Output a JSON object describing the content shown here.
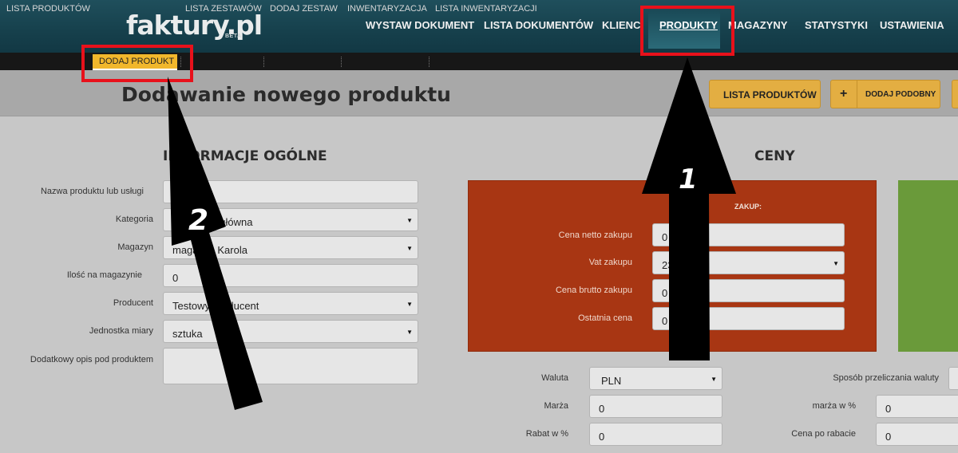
{
  "header": {
    "logo": "faktury.pl",
    "logo_badge": "BETA",
    "nav": [
      "WYSTAW DOKUMENT",
      "LISTA DOKUMENTÓW",
      "KLIENCI",
      "PRODUKTY",
      "MAGAZYNY",
      "STATYSTYKI",
      "USTAWIENIA"
    ],
    "nav_active": "PRODUKTY"
  },
  "subnav": {
    "items": [
      "LISTA PRODUKTÓW",
      "DODAJ PRODUKT",
      "LISTA ZESTAWÓW",
      "DODAJ ZESTAW",
      "INWENTARYZACJA",
      "LISTA INWENTARYZACJI"
    ],
    "active": "DODAJ PRODUKT"
  },
  "page": {
    "title": "Dodawanie nowego produktu",
    "buttons": {
      "list": "LISTA PRODUKTÓW",
      "add_similar_icon": "+",
      "add_similar": "DODAJ PODOBNY"
    }
  },
  "general": {
    "heading": "INFORMACJE OGÓLNE",
    "fields": [
      {
        "label": "Nazwa produktu lub usługi",
        "value": "",
        "type": "text"
      },
      {
        "label": "Kategoria",
        "value": "Kategoria główna",
        "type": "select"
      },
      {
        "label": "Magazyn",
        "value": "magazyn Karola",
        "type": "select"
      },
      {
        "label": "Ilość na magazynie",
        "value": "0",
        "type": "text"
      },
      {
        "label": "Producent",
        "value": "Testowy producent",
        "type": "select"
      },
      {
        "label": "Jednostka miary",
        "value": "sztuka",
        "type": "select"
      },
      {
        "label": "Dodatkowy opis pod produktem",
        "value": "",
        "type": "textarea"
      }
    ]
  },
  "prices": {
    "heading": "CENY",
    "purchase": {
      "title": "ZAKUP:",
      "fields": [
        {
          "label": "Cena netto zakupu",
          "value": "0"
        },
        {
          "label": "Vat zakupu",
          "value": "23%",
          "type": "select"
        },
        {
          "label": "Cena brutto zakupu",
          "value": "0"
        },
        {
          "label": "Ostatnia cena",
          "value": "0"
        }
      ]
    },
    "currency": {
      "label": "Waluta",
      "value": "PLN"
    },
    "margin": {
      "label": "Marża",
      "value": "0"
    },
    "discount": {
      "label": "Rabat w %",
      "value": "0"
    },
    "conversion": {
      "label": "Sposób przeliczania waluty"
    },
    "margin_pct": {
      "label": "marża w %",
      "value": "0"
    },
    "price_after_discount": {
      "label": "Cena po rabacie",
      "value": "0"
    }
  },
  "annotations": {
    "step1": "1",
    "step2": "2",
    "color": "#e8111b"
  }
}
